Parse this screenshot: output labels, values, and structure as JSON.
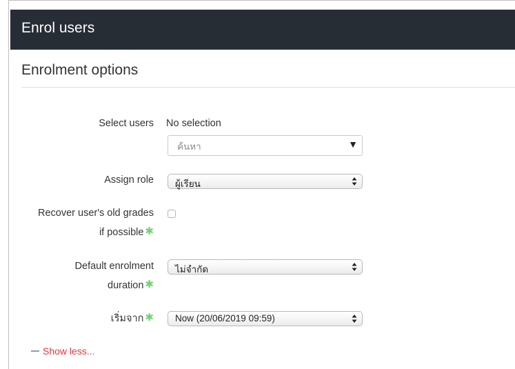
{
  "dialog": {
    "title": "Enrol users"
  },
  "section": {
    "title": "Enrolment options"
  },
  "select_users": {
    "label": "Select users",
    "current": "No selection",
    "search_placeholder": "ค้นหา",
    "dropdown_icon": "triangle-down-icon"
  },
  "assign_role": {
    "label": "Assign role",
    "value": "ผู้เรียน"
  },
  "recover_grades": {
    "label_line1": "Recover user's old grades",
    "label_line2": "if possible",
    "checked": false
  },
  "default_duration": {
    "label_line1": "Default enrolment",
    "label_line2": "duration",
    "value": "ไม่จำกัด"
  },
  "start_from": {
    "label": "เริ่มจาก",
    "value": "Now (20/06/2019 09:59)"
  },
  "show_less": {
    "label": "Show less..."
  },
  "colors": {
    "header_bg": "#262d35",
    "link": "#e8363b",
    "help_icon": "#6fd36f"
  }
}
